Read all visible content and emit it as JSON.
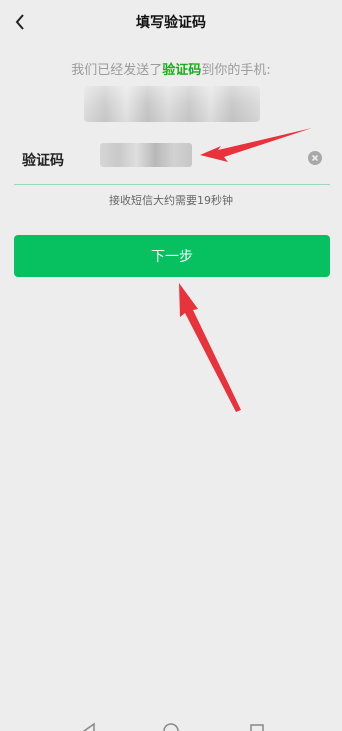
{
  "header": {
    "title": "填写验证码"
  },
  "message": {
    "prefix": "我们已经发送了",
    "highlight": "验证码",
    "suffix": "到你的手机:"
  },
  "form": {
    "code_label": "验证码",
    "hint": "接收短信大约需要19秒钟"
  },
  "actions": {
    "next_label": "下一步"
  },
  "colors": {
    "accent": "#07c160",
    "highlight_text": "#1aad19",
    "arrow": "#e8323c",
    "background": "#ededed"
  },
  "icons": {
    "back": "chevron-left-icon",
    "clear": "clear-x-icon",
    "nav_back": "triangle-back-icon",
    "nav_home": "circle-home-icon",
    "nav_recent": "square-recent-icon"
  }
}
